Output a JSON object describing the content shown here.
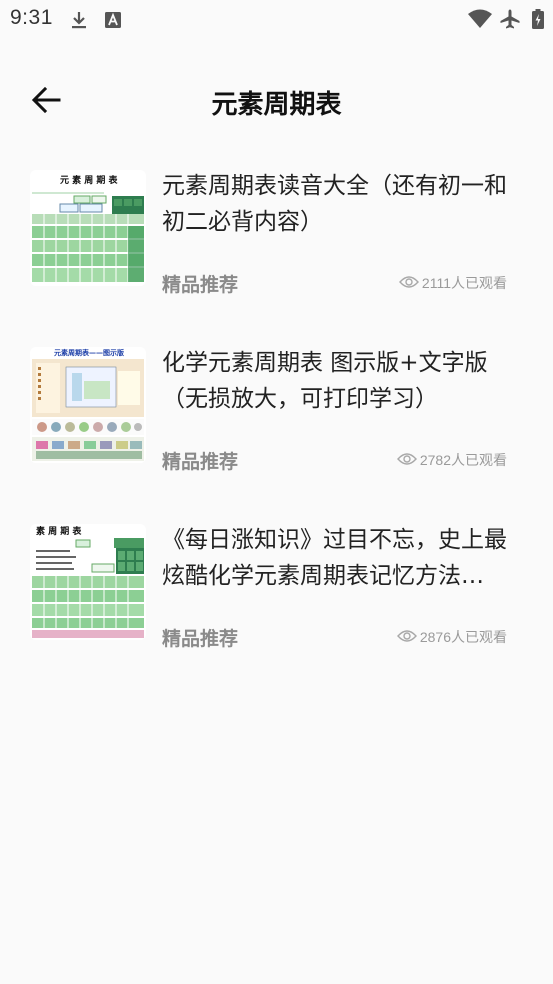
{
  "status_bar": {
    "time": "9:31",
    "icons": [
      "download-icon",
      "text-app-icon",
      "wifi-icon",
      "airplane-icon",
      "battery-charging-icon"
    ]
  },
  "header": {
    "title": "元素周期表",
    "back_icon": "arrow-left-icon"
  },
  "articles": [
    {
      "title": "元素周期表读音大全（还有初一和初二必背内容）",
      "tag": "精品推荐",
      "views": "2111人已观看",
      "thumb_caption": "元 素 周 期 表"
    },
    {
      "title": "化学元素周期表 图示版+文字版（无损放大，可打印学习）",
      "tag": "精品推荐",
      "views": "2782人已观看",
      "thumb_caption": "元素周期表——图示版"
    },
    {
      "title": "《每日涨知识》过目不忘，史上最炫酷化学元素周期表记忆方法…",
      "tag": "精品推荐",
      "views": "2876人已观看",
      "thumb_caption": "素 周 期 表"
    }
  ],
  "colors": {
    "background": "#fafafa",
    "title": "#111111",
    "muted": "#8a8a8a",
    "table_green": "#7fc48a",
    "table_dark_green": "#2e7d4f"
  }
}
